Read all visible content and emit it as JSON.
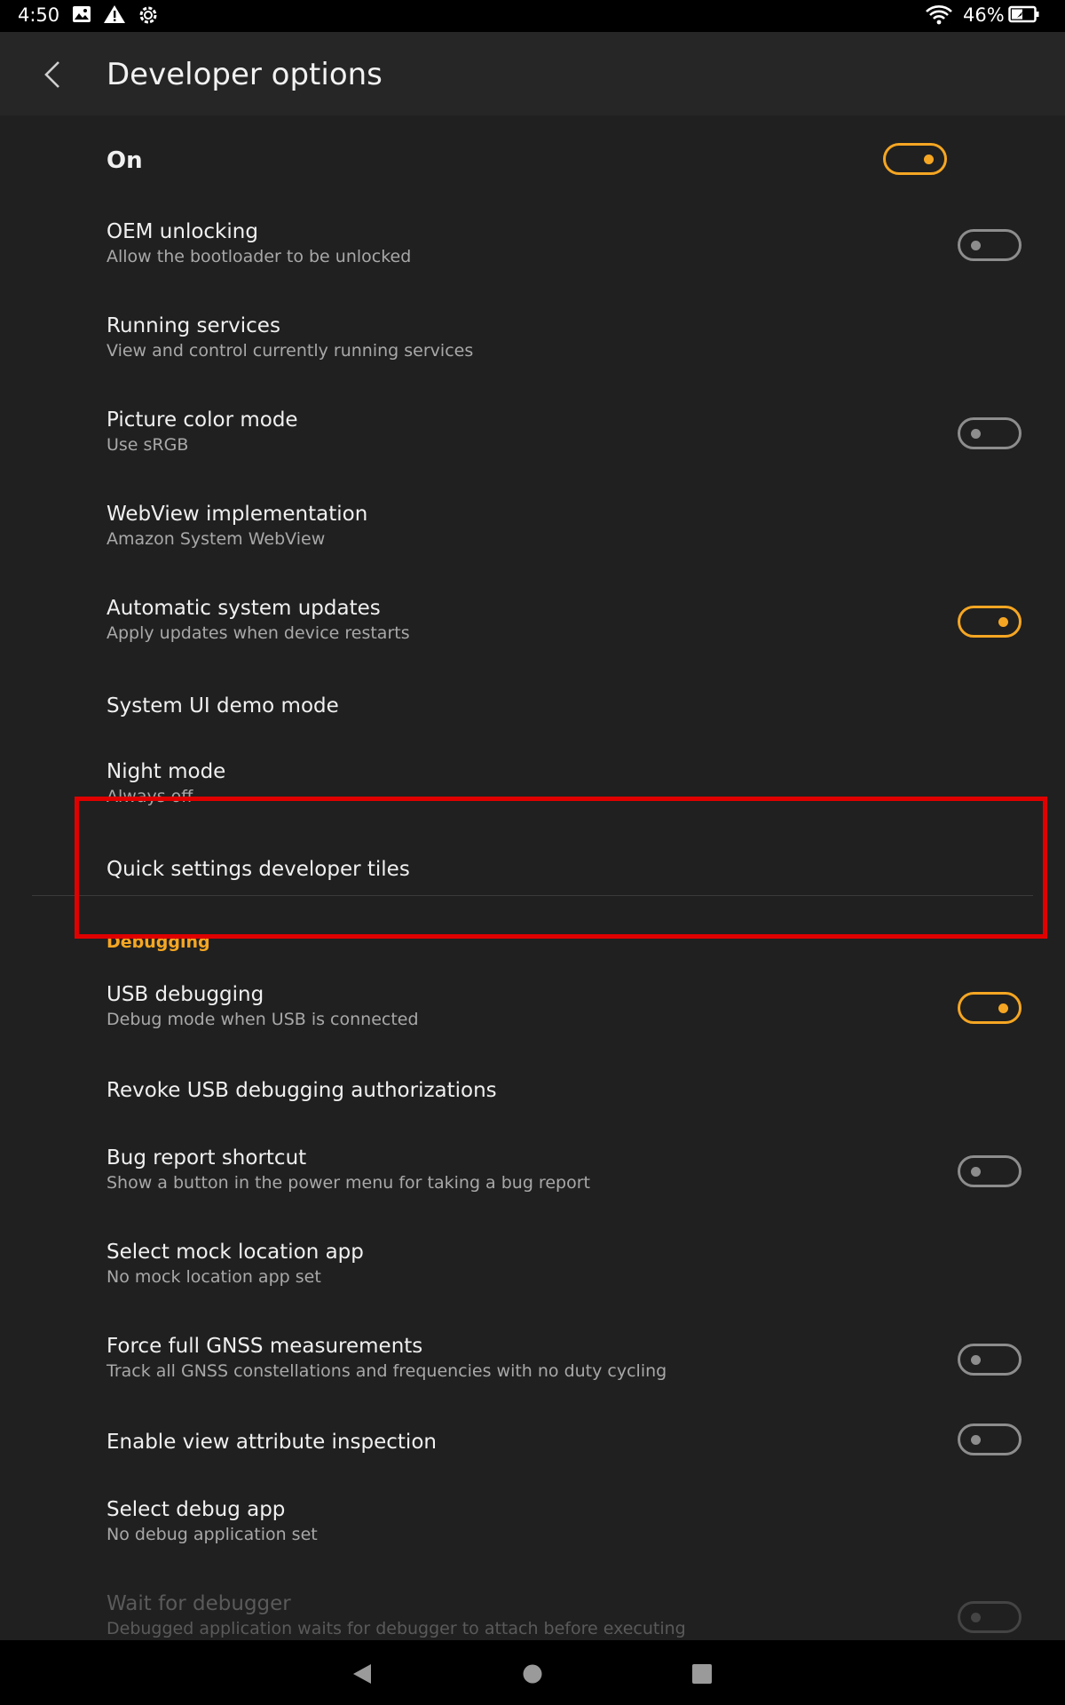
{
  "status_bar": {
    "time": "4:50",
    "battery": "46%"
  },
  "header": {
    "title": "Developer options"
  },
  "master": {
    "label": "On",
    "on": true
  },
  "settings": [
    {
      "title": "OEM unlocking",
      "subtitle": "Allow the bootloader to be unlocked",
      "toggle": "off"
    },
    {
      "title": "Running services",
      "subtitle": "View and control currently running services"
    },
    {
      "title": "Picture color mode",
      "subtitle": "Use sRGB",
      "toggle": "off"
    },
    {
      "title": "WebView implementation",
      "subtitle": "Amazon System WebView"
    },
    {
      "title": "Automatic system updates",
      "subtitle": "Apply updates when device restarts",
      "toggle": "on"
    },
    {
      "title": "System UI demo mode"
    },
    {
      "title": "Night mode",
      "subtitle": "Always off"
    },
    {
      "title": "Quick settings developer tiles"
    }
  ],
  "debugging": {
    "header": "Debugging",
    "items": [
      {
        "title": "USB debugging",
        "subtitle": "Debug mode when USB is connected",
        "toggle": "on"
      },
      {
        "title": "Revoke USB debugging authorizations"
      },
      {
        "title": "Bug report shortcut",
        "subtitle": "Show a button in the power menu for taking a bug report",
        "toggle": "off"
      },
      {
        "title": "Select mock location app",
        "subtitle": "No mock location app set"
      },
      {
        "title": "Force full GNSS measurements",
        "subtitle": "Track all GNSS constellations and frequencies with no duty cycling",
        "toggle": "off"
      },
      {
        "title": "Enable view attribute inspection",
        "toggle": "off"
      },
      {
        "title": "Select debug app",
        "subtitle": "No debug application set"
      },
      {
        "title": "Wait for debugger",
        "subtitle": "Debugged application waits for debugger to attach before executing",
        "toggle": "off",
        "disabled": true
      }
    ]
  },
  "colors": {
    "accent": "#f5a623",
    "background": "#202020",
    "highlight": "#e00000"
  },
  "icons": [
    "image-icon",
    "warning-icon",
    "gear-icon",
    "wifi-icon",
    "battery-charging-icon",
    "back-arrow-icon",
    "nav-back-icon",
    "nav-home-icon",
    "nav-recents-icon"
  ]
}
